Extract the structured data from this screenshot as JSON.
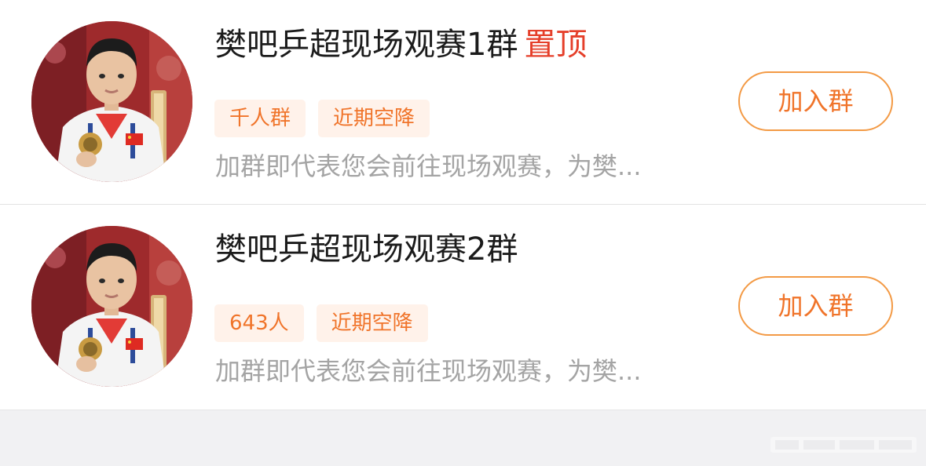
{
  "groups": [
    {
      "name": "樊吧乒超现场观赛1群",
      "pinned_label": "置顶",
      "tags": [
        "千人群",
        "近期空降"
      ],
      "description": "加群即代表您会前往现场观赛，为樊...",
      "join_label": "加入群"
    },
    {
      "name": "樊吧乒超现场观赛2群",
      "pinned_label": "",
      "tags": [
        "643人",
        "近期空降"
      ],
      "description": "加群即代表您会前往现场观赛，为樊...",
      "join_label": "加入群"
    }
  ],
  "colors": {
    "accent": "#f0742a",
    "pinned": "#e53f2a",
    "tag_bg": "#fff2ea",
    "text_primary": "#1b1b1b",
    "text_secondary": "#a4a4a4",
    "footer_bg": "#f1f1f3"
  },
  "icons": {
    "avatar": "player-photo-avatar"
  }
}
